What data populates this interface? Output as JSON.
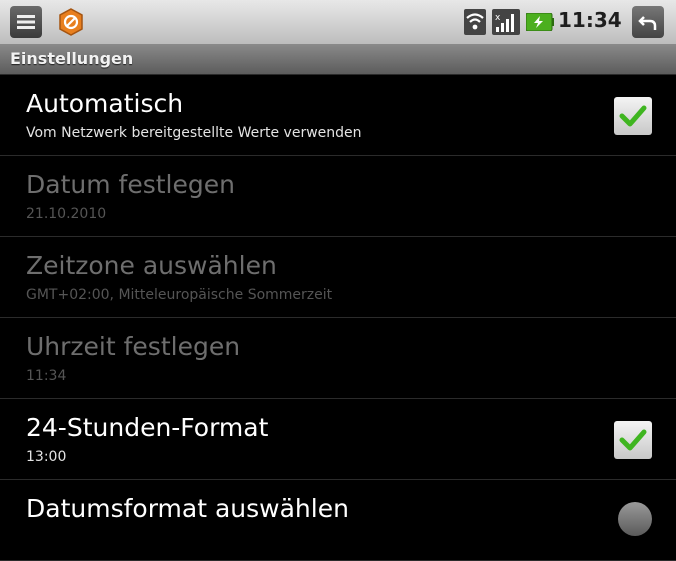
{
  "status_bar": {
    "time": "11:34",
    "icons": [
      "menu-icon",
      "app-icon",
      "wifi-icon",
      "signal-icon",
      "battery-icon",
      "back-icon"
    ]
  },
  "title_bar": {
    "title": "Einstellungen"
  },
  "settings": [
    {
      "title": "Automatisch",
      "summary": "Vom Netzwerk bereitgestellte Werte verwenden",
      "enabled": true,
      "control": "checkbox",
      "checked": true
    },
    {
      "title": "Datum festlegen",
      "summary": "21.10.2010",
      "enabled": false
    },
    {
      "title": "Zeitzone auswählen",
      "summary": "GMT+02:00, Mitteleuropäische Sommerzeit",
      "enabled": false
    },
    {
      "title": "Uhrzeit festlegen",
      "summary": "11:34",
      "enabled": false
    },
    {
      "title": "24-Stunden-Format",
      "summary": "13:00",
      "enabled": true,
      "control": "checkbox",
      "checked": true
    },
    {
      "title": "Datumsformat auswählen",
      "summary": "",
      "enabled": true,
      "control": "radio"
    }
  ],
  "colors": {
    "check_green": "#3fb520",
    "accent_orange": "#e87f1e",
    "battery_green": "#4caf1f"
  }
}
